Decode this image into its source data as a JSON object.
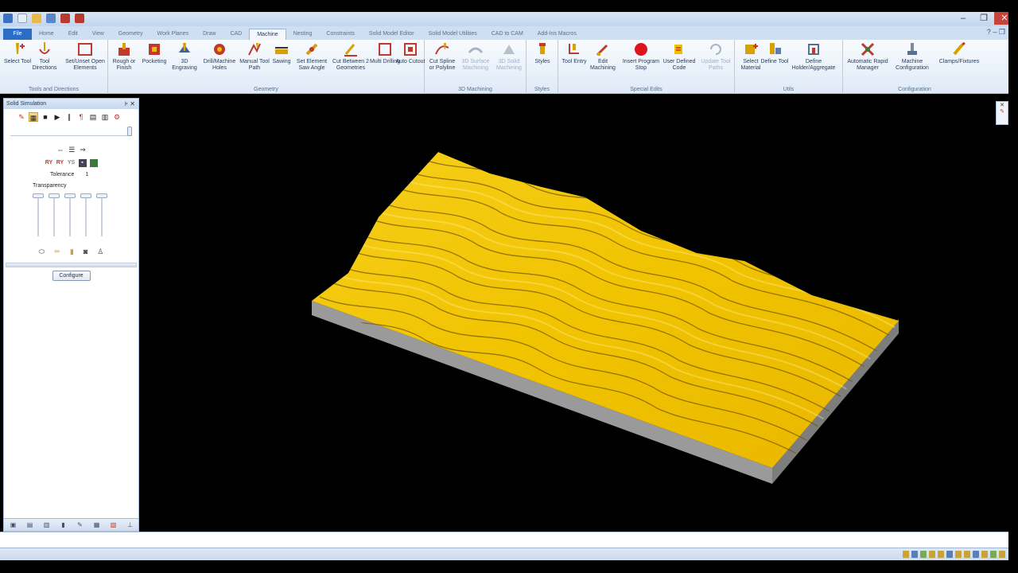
{
  "window": {
    "title": "",
    "controls": [
      "–",
      "❐",
      "✕"
    ]
  },
  "ribbon_tabs": [
    "File",
    "Home",
    "Edit",
    "View",
    "Geometry",
    "Work Planes",
    "Draw",
    "CAD",
    "Machine",
    "Nesting",
    "Constraints",
    "Solid Model Editor",
    "Solid Model Utilities",
    "CAD to CAM",
    "Add-Ins Macros"
  ],
  "active_tab": "Machine",
  "ribbon_groups": [
    {
      "name": "Tools and Directions",
      "buttons": [
        {
          "label": "Select Tool",
          "icon": "select-tool-icon"
        },
        {
          "label": "Tool Directions",
          "icon": "tool-directions-icon"
        },
        {
          "label": "Set/Unset Open Elements",
          "icon": "open-elements-icon"
        }
      ]
    },
    {
      "name": "Geometry",
      "buttons": [
        {
          "label": "Rough or Finish",
          "icon": "rough-finish-icon"
        },
        {
          "label": "Pocketing",
          "icon": "pocketing-icon"
        },
        {
          "label": "3D Engraving",
          "icon": "engraving-icon"
        },
        {
          "label": "Drill/Machine Holes",
          "icon": "drill-icon"
        },
        {
          "label": "Manual Tool Path",
          "icon": "manual-toolpath-icon"
        },
        {
          "label": "Sawing",
          "icon": "sawing-icon"
        },
        {
          "label": "Set Element Saw Angle",
          "icon": "saw-angle-icon"
        },
        {
          "label": "Cut Between 2 Geometries",
          "icon": "cut-between-icon"
        },
        {
          "label": "Multi Drilling",
          "icon": "multi-drilling-icon"
        },
        {
          "label": "Auto Cutout",
          "icon": "auto-cutout-icon"
        }
      ]
    },
    {
      "name": "3D Machining",
      "buttons": [
        {
          "label": "Cut Spline or Polyline",
          "icon": "cut-spline-icon"
        },
        {
          "label": "3D Surface Machining",
          "icon": "surface-machining-icon"
        },
        {
          "label": "3D Solid Machining",
          "icon": "solid-machining-icon"
        }
      ]
    },
    {
      "name": "Styles",
      "buttons": [
        {
          "label": "Styles",
          "icon": "styles-icon"
        }
      ]
    },
    {
      "name": "Special Edits",
      "buttons": [
        {
          "label": "Tool Entry",
          "icon": "tool-entry-icon"
        },
        {
          "label": "Edit Machining",
          "icon": "edit-machining-icon"
        },
        {
          "label": "Insert Program Stop",
          "icon": "program-stop-icon"
        },
        {
          "label": "User Defined Code",
          "icon": "user-code-icon"
        },
        {
          "label": "Update Tool Paths",
          "icon": "update-toolpaths-icon"
        }
      ]
    },
    {
      "name": "Utils",
      "buttons": [
        {
          "label": "Select Material",
          "icon": "select-material-icon"
        },
        {
          "label": "Define Tool",
          "icon": "define-tool-icon"
        },
        {
          "label": "Define Holder/Aggregate",
          "icon": "define-holder-icon"
        }
      ]
    },
    {
      "name": "Configuration",
      "buttons": [
        {
          "label": "Automatic Rapid Manager",
          "icon": "rapid-manager-icon"
        },
        {
          "label": "Machine Configuration",
          "icon": "machine-config-icon"
        },
        {
          "label": "Clamps/Fixtures",
          "icon": "clamps-icon"
        }
      ]
    }
  ],
  "panel": {
    "title": "Solid Simulation",
    "tolerance_label": "Tolerance",
    "tolerance_value": "1",
    "transparency_label": "Transparency",
    "configure_label": "Configure"
  },
  "colors": {
    "material_gold": "#f2c200",
    "material_gold_dark": "#7a5a00",
    "block_side": "#9a9a9a",
    "block_front": "#7d7d7d",
    "ribbon_blue": "#2b6cc4"
  }
}
